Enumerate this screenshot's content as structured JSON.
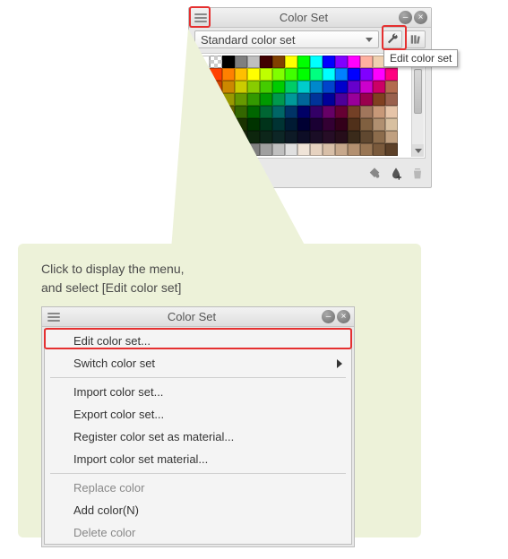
{
  "top_panel": {
    "title": "Color Set",
    "dropdown_label": "Standard color set",
    "tooltip": "Edit color set",
    "footer_chips": [
      "#b02020",
      "#109020",
      "#1030a0"
    ]
  },
  "callout": {
    "line1": "Click to display the menu,",
    "line2": "and select [Edit color set]"
  },
  "bottom_panel": {
    "title": "Color Set",
    "menu": {
      "edit": "Edit color set...",
      "switch": "Switch color set",
      "import": "Import color set...",
      "export": "Export color set...",
      "register": "Register color set as material...",
      "import_material": "Import color set material...",
      "replace": "Replace color",
      "add": "Add color(N)",
      "delete": "Delete color"
    }
  },
  "swatches": [
    "#ffffff",
    "checker",
    "#000000",
    "#7f7f7f",
    "#bfbfbf",
    "#400000",
    "#804000",
    "#ffff00",
    "#00ff00",
    "#00ffff",
    "#0000ff",
    "#8000ff",
    "#ff00ff",
    "#ffb0a0",
    "#f0d0b0",
    "#ffe8d0",
    "#ff0000",
    "#ff4000",
    "#ff8000",
    "#ffbf00",
    "#ffff00",
    "#bfff00",
    "#80ff00",
    "#40ff00",
    "#00ff00",
    "#00ff80",
    "#00ffff",
    "#0080ff",
    "#0000ff",
    "#8000ff",
    "#ff00ff",
    "#ff0080",
    "#cc0000",
    "#cc4400",
    "#cc8800",
    "#cccc00",
    "#88cc00",
    "#44cc00",
    "#00cc00",
    "#00cc66",
    "#00cccc",
    "#0088cc",
    "#0044cc",
    "#0000cc",
    "#6600cc",
    "#cc00cc",
    "#cc0066",
    "#b36b4f",
    "#990000",
    "#994d00",
    "#999900",
    "#669900",
    "#339900",
    "#009900",
    "#00994d",
    "#009999",
    "#006699",
    "#003399",
    "#000099",
    "#4d0099",
    "#990099",
    "#99004d",
    "#804020",
    "#99604d",
    "#660000",
    "#663300",
    "#666600",
    "#336600",
    "#006600",
    "#006633",
    "#006666",
    "#003366",
    "#000066",
    "#330066",
    "#660066",
    "#660033",
    "#734026",
    "#a0765c",
    "#c79878",
    "#e6c4a8",
    "#330000",
    "#331a00",
    "#333300",
    "#1a3300",
    "#003300",
    "#00331a",
    "#003333",
    "#001a33",
    "#000033",
    "#1a0033",
    "#330033",
    "#33001a",
    "#50301a",
    "#806040",
    "#b09070",
    "#d8c0a0",
    "#1a0d0d",
    "#261a0d",
    "#26260d",
    "#1a260d",
    "#0d260d",
    "#0d261a",
    "#0d2626",
    "#0d1a26",
    "#0d0d26",
    "#1a0d26",
    "#260d26",
    "#260d1a",
    "#3a2a1a",
    "#604830",
    "#8c6c4c",
    "#c0a080",
    "#000000",
    "#202020",
    "#404040",
    "#606060",
    "#808080",
    "#a0a0a0",
    "#c0c0c0",
    "#e0e0e0",
    "#f0e4d8",
    "#e6d2c0",
    "#d8bfa8",
    "#c7a88c",
    "#b39070",
    "#997654",
    "#7a5a3c",
    "#5c4028"
  ]
}
